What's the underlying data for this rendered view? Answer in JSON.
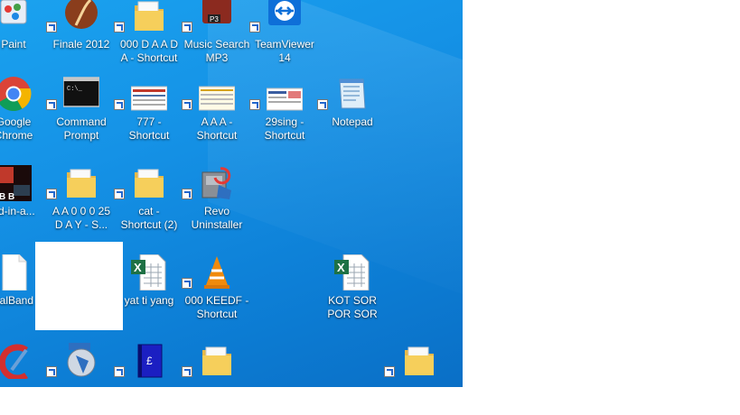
{
  "desktop": {
    "icons": [
      {
        "label": "Paint",
        "icon": "paint-icon"
      },
      {
        "label": "Finale 2012",
        "icon": "finale-icon"
      },
      {
        "label": "000 D A A  D\nA - Shortcut",
        "icon": "folder-icon"
      },
      {
        "label": "Music Search\nMP3",
        "icon": "music-search-icon"
      },
      {
        "label": "TeamViewer\n14",
        "icon": "teamviewer-icon"
      },
      {
        "label": "Google\nChrome",
        "icon": "chrome-icon"
      },
      {
        "label": "Command\nPrompt",
        "icon": "cmd-icon"
      },
      {
        "label": "777 -\nShortcut",
        "icon": "doc-thumb-icon"
      },
      {
        "label": "A  A  A -\nShortcut",
        "icon": "doc-thumb-icon"
      },
      {
        "label": "29sing -\nShortcut",
        "icon": "doc-thumb-icon"
      },
      {
        "label": "Notepad",
        "icon": "notepad-icon"
      },
      {
        "label": "nd-in-a...",
        "icon": "band-in-a-box-icon"
      },
      {
        "label": "A A 0 0 0 25\nD A  Y - S...",
        "icon": "folder-icon"
      },
      {
        "label": "cat -\nShortcut (2)",
        "icon": "folder-icon"
      },
      {
        "label": "Revo\nUninstaller",
        "icon": "revo-uninstaller-icon"
      },
      {
        "label": "ealBand",
        "icon": "blank-file-icon"
      },
      {
        "label": "yat ti yang",
        "icon": "excel-icon"
      },
      {
        "label": "000  KEEDF -\nShortcut",
        "icon": "vlc-icon"
      },
      {
        "label": "KOT SOR\nPOR  SOR",
        "icon": "excel-icon"
      },
      {
        "label": "",
        "icon": "ccleaner-icon"
      },
      {
        "label": "",
        "icon": "installer-icon"
      },
      {
        "label": "",
        "icon": "blue-book-icon"
      },
      {
        "label": "",
        "icon": "folder-icon"
      },
      {
        "label": "",
        "icon": "folder-icon"
      }
    ]
  },
  "colors": {
    "desktop_bg": "#1592e6",
    "label_text": "#ffffff"
  }
}
